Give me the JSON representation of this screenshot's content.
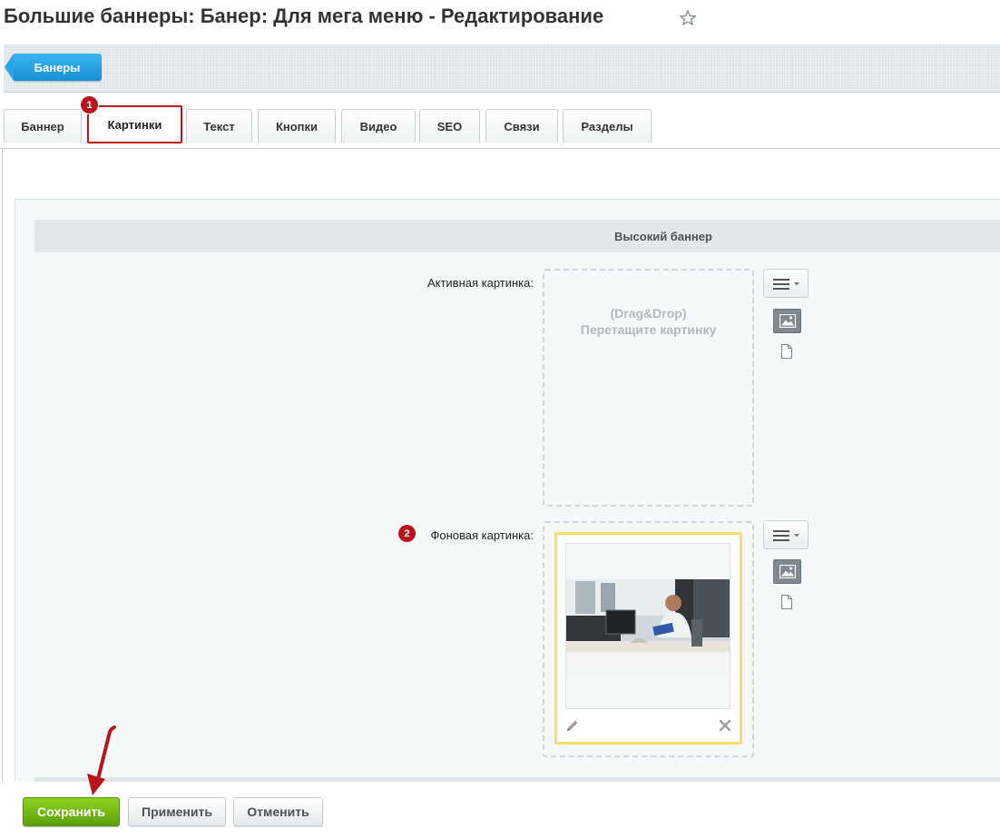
{
  "page": {
    "title": "Большие баннеры: Банер: Для мега меню - Редактирование"
  },
  "toolbar": {
    "back_label": "Банеры"
  },
  "tabs": [
    {
      "label": "Баннер"
    },
    {
      "label": "Картинки",
      "active": true,
      "badge": "1"
    },
    {
      "label": "Текст"
    },
    {
      "label": "Кнопки"
    },
    {
      "label": "Видео"
    },
    {
      "label": "SEO"
    },
    {
      "label": "Связи"
    },
    {
      "label": "Разделы"
    }
  ],
  "section": {
    "header": "Высокий баннер"
  },
  "fields": {
    "active_image": {
      "label": "Активная картинка:",
      "drop_hint_line1": "(Drag&Drop)",
      "drop_hint_line2": "Перетащите картинку"
    },
    "background_image": {
      "label": "Фоновая картинка:",
      "badge": "2"
    }
  },
  "buttons": {
    "save": "Сохранить",
    "apply": "Применить",
    "cancel": "Отменить"
  },
  "colors": {
    "accent_blue": "#1a8fd7",
    "save_green": "#5aa10d",
    "annotation_red": "#c0141b",
    "highlight_yellow": "#f7dc6f"
  },
  "icons": {
    "star": "star-icon",
    "menu": "hamburger-icon",
    "image": "image-icon",
    "file": "file-icon",
    "edit": "pencil-icon",
    "remove": "close-icon"
  }
}
